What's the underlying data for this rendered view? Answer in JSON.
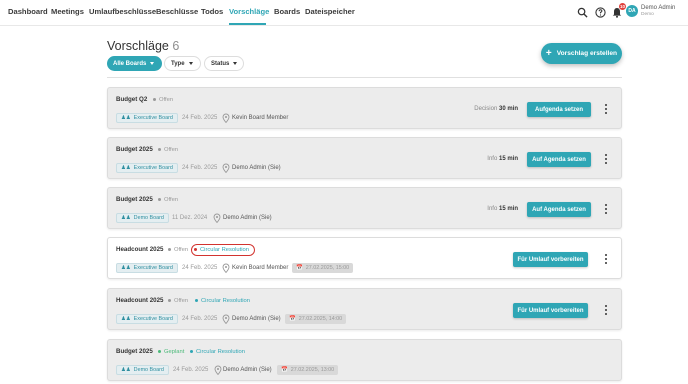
{
  "nav": {
    "items": [
      "Dashboard",
      "Meetings",
      "Umlaufbeschlüsse",
      "Beschlüsse",
      "Todos",
      "Vorschläge",
      "Boards",
      "Dateispeicher"
    ],
    "active": "Vorschläge",
    "notifications_count": "10"
  },
  "user": {
    "initials": "DA",
    "name": "Demo Admin",
    "org": "Demo"
  },
  "page": {
    "title": "Vorschläge",
    "count": "6"
  },
  "filters": {
    "boards": "Alle Boards",
    "type": "Type",
    "status": "Status"
  },
  "create_button": "Vorschlag erstellen",
  "icons": {
    "search": "search-icon",
    "help": "help-icon",
    "bell": "bell-icon",
    "board": "group-icon",
    "location": "pin-icon",
    "calendar": "calendar-icon",
    "more": "kebab-icon"
  },
  "colors": {
    "accent": "#2fa6b5",
    "open": "#999999",
    "planned": "#4cba7a",
    "highlight": "#d2332f"
  },
  "proposals": [
    {
      "title": "Budget Q2",
      "status": "Offen",
      "circular": "",
      "board": "Executive Board",
      "date": "24 Feb. 2025",
      "person": "Kevin Board Member",
      "deadline": "",
      "duration_type": "Decision",
      "duration": "30 min",
      "action": "Aufgenda setzen"
    },
    {
      "title": "Budget 2025",
      "status": "Offen",
      "circular": "",
      "board": "Executive Board",
      "date": "24 Feb. 2025",
      "person": "Demo Admin (Sie)",
      "deadline": "",
      "duration_type": "Info",
      "duration": "15 min",
      "action": "Auf Agenda setzen"
    },
    {
      "title": "Budget 2025",
      "status": "Offen",
      "circular": "",
      "board": "Demo Board",
      "date": "11 Dez. 2024",
      "person": "Demo Admin (Sie)",
      "deadline": "",
      "duration_type": "Info",
      "duration": "15 min",
      "action": "Auf Agenda setzen"
    },
    {
      "title": "Headcount 2025",
      "status": "Offen",
      "circular": "Circular Resolution",
      "board": "Executive Board",
      "date": "24 Feb. 2025",
      "person": "Kevin Board Member",
      "deadline": "27.02.2025, 15:00",
      "duration_type": "",
      "duration": "",
      "action": "Für Umlauf vorbereiten"
    },
    {
      "title": "Headcount 2025",
      "status": "Offen",
      "circular": "Circular Resolution",
      "board": "Executive Board",
      "date": "24 Feb. 2025",
      "person": "Demo Admin (Sie)",
      "deadline": "27.02.2025, 14:00",
      "duration_type": "",
      "duration": "",
      "action": "Für Umlauf vorbereiten"
    },
    {
      "title": "Budget 2025",
      "status": "Geplant",
      "circular": "Circular Resolution",
      "board": "Demo Board",
      "date": "24 Feb. 2025",
      "person": "Demo Admin (Sie)",
      "deadline": "27.02.2025, 13:00",
      "duration_type": "",
      "duration": "",
      "action": ""
    }
  ]
}
